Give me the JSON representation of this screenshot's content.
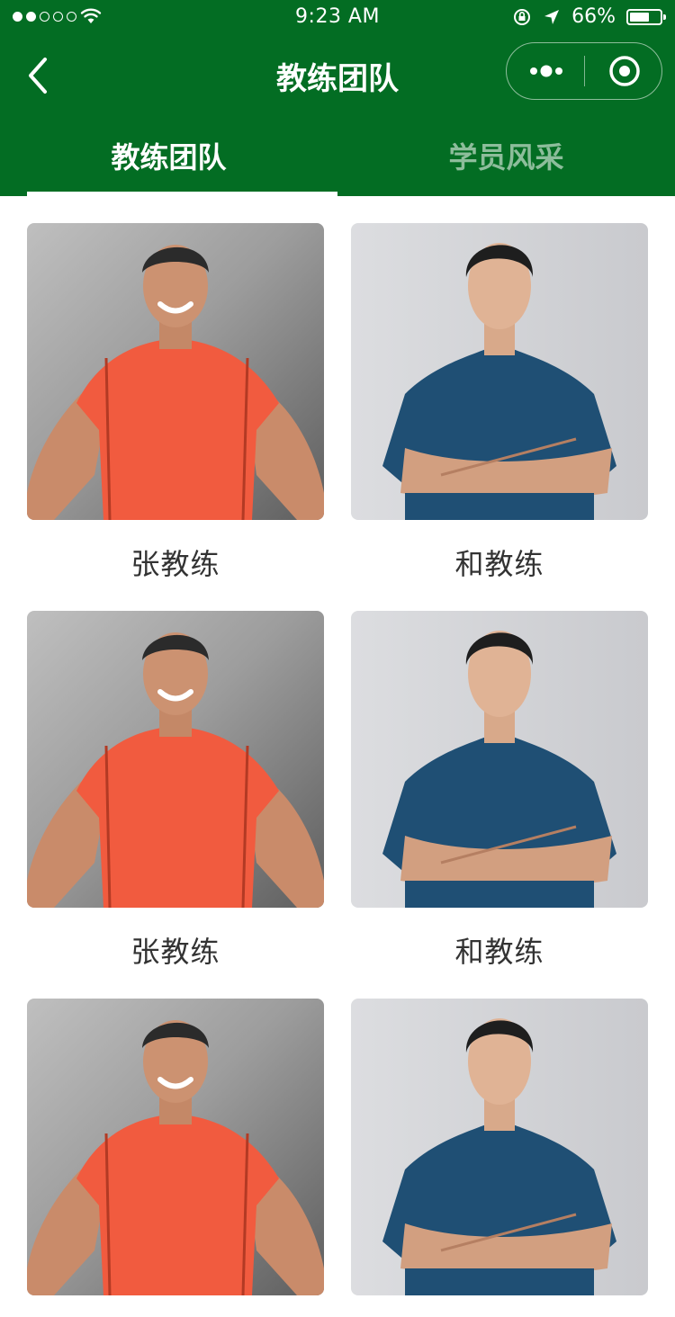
{
  "status_bar": {
    "time": "9:23 AM",
    "battery_percent": "66%",
    "battery_level": 0.66,
    "signal_bars_on": 2,
    "signal_bars_total": 5
  },
  "nav": {
    "title": "教练团队"
  },
  "tabs": [
    {
      "label": "教练团队",
      "active": true
    },
    {
      "label": "学员风采",
      "active": false
    }
  ],
  "colors": {
    "primary": "#036d23",
    "orange_shirt": "#f15b3f",
    "navy_shirt": "#1f4f74"
  },
  "coaches": [
    {
      "name": "张教练",
      "shirt": "orange"
    },
    {
      "name": "和教练",
      "shirt": "navy"
    },
    {
      "name": "张教练",
      "shirt": "orange"
    },
    {
      "name": "和教练",
      "shirt": "navy"
    },
    {
      "name": "",
      "shirt": "orange"
    },
    {
      "name": "",
      "shirt": "navy"
    }
  ]
}
